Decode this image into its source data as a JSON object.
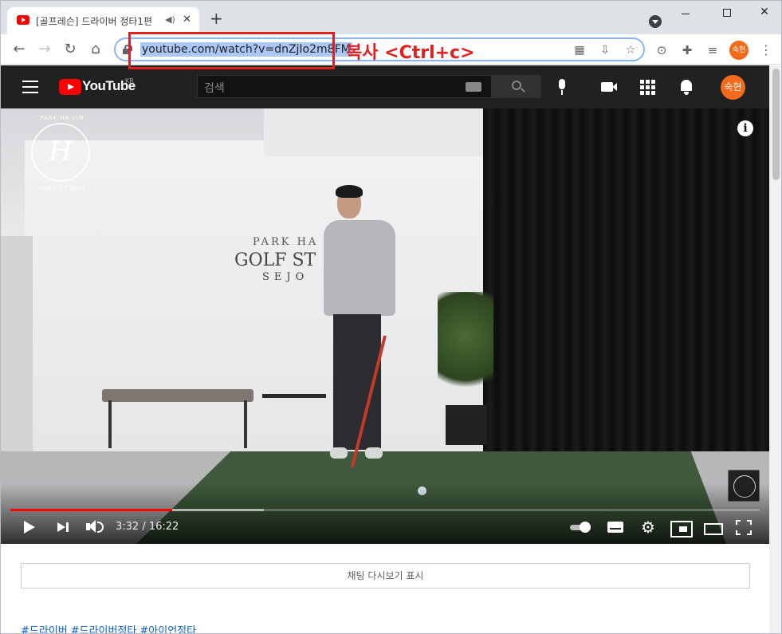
{
  "browser": {
    "tab": {
      "title": "[골프레슨] 드라이버 정타1편",
      "audio_icon": "speaker-icon",
      "close_glyph": "✕"
    },
    "new_tab_glyph": "+",
    "window_controls": {
      "close_glyph": "✕"
    },
    "nav": {
      "back": "←",
      "forward": "→",
      "reload": "↻",
      "home": "⌂"
    },
    "address_bar": {
      "url": "youtube.com/watch?v=dnZjIo2m8FM"
    },
    "omnibox_icons": [
      "qr-code-icon",
      "install-icon",
      "bookmark-star-icon"
    ],
    "extensions": [
      "mouse-icon",
      "puzzle-icon",
      "media-control-icon"
    ],
    "profile_label": "숙현",
    "menu_glyph": "⋮"
  },
  "annotation": {
    "text": "복사 <Ctrl+c>",
    "color": "#e32020"
  },
  "youtube": {
    "wordmark": "YouTube",
    "region": "KR",
    "search_placeholder": "검색",
    "avatar_label": "숙현",
    "accent": "#ff0000"
  },
  "video": {
    "logo_letter": "H",
    "logo_top_text": "PARK HA LIM",
    "logo_bottom_text": "GOLF STUDIO",
    "sign_line1": "PARK HA",
    "sign_line2": "GOLF ST",
    "sign_line3": "SEJO",
    "info_glyph": "i",
    "player": {
      "time_display": "3:32 / 16:22",
      "progress_percent": 21.6,
      "buffered_percent": 33.8,
      "settings_glyph": "⚙"
    }
  },
  "below_video": {
    "chat_replay_label": "채팅 다시보기 표시",
    "hashtags": [
      "#드라이버",
      "#드라이버정타",
      "#아이언정타"
    ]
  }
}
